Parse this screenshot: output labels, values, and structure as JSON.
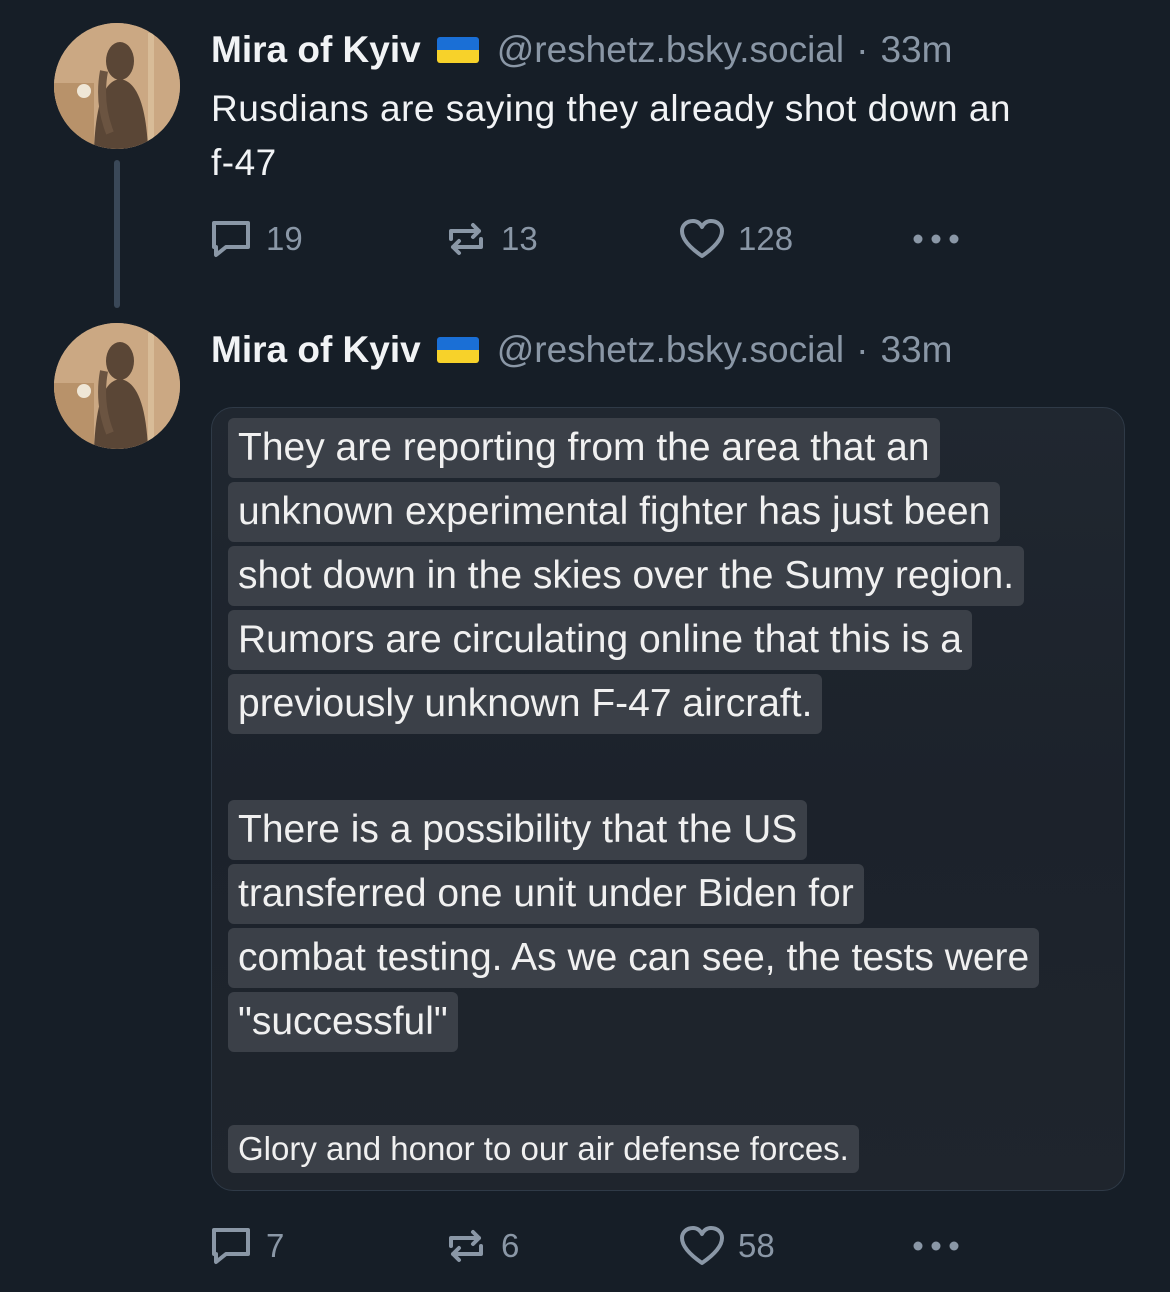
{
  "posts": [
    {
      "author": {
        "display_name": "Mira of Kyiv",
        "flag_icon": "ukraine-flag-icon",
        "handle": "@reshetz.bsky.social",
        "separator": "·",
        "time": "33m"
      },
      "text_lines": [
        "Rusdians are saying they already shot down an",
        "f-47"
      ],
      "stats": {
        "replies": "19",
        "reposts": "13",
        "likes": "128"
      }
    },
    {
      "author": {
        "display_name": "Mira of Kyiv",
        "flag_icon": "ukraine-flag-icon",
        "handle": "@reshetz.bsky.social",
        "separator": "·",
        "time": "33m"
      },
      "embed_image": {
        "paragraph_1": [
          "They are reporting from the area that an",
          "unknown experimental fighter has just been",
          "shot down in the skies over the Sumy region.",
          "Rumors are circulating online that this is a",
          "previously unknown F-47 aircraft."
        ],
        "paragraph_2": [
          "There is a possibility that the US",
          "transferred one unit under Biden for",
          "combat testing. As we can see, the tests were",
          "\"successful\""
        ],
        "paragraph_3": [
          "Glory and honor to our air defense forces."
        ]
      },
      "stats": {
        "replies": "7",
        "reposts": "6",
        "likes": "58"
      }
    }
  ],
  "icons": {
    "reply": "speech-bubble-icon",
    "repost": "repost-arrows-icon",
    "like": "heart-icon",
    "more": "more-dots-icon"
  },
  "colors": {
    "background": "#161e27",
    "muted_text": "#8a97a6",
    "highlight_bg": "#3b4048",
    "flag_blue": "#1a6fd6",
    "flag_yellow": "#f7d22a"
  }
}
